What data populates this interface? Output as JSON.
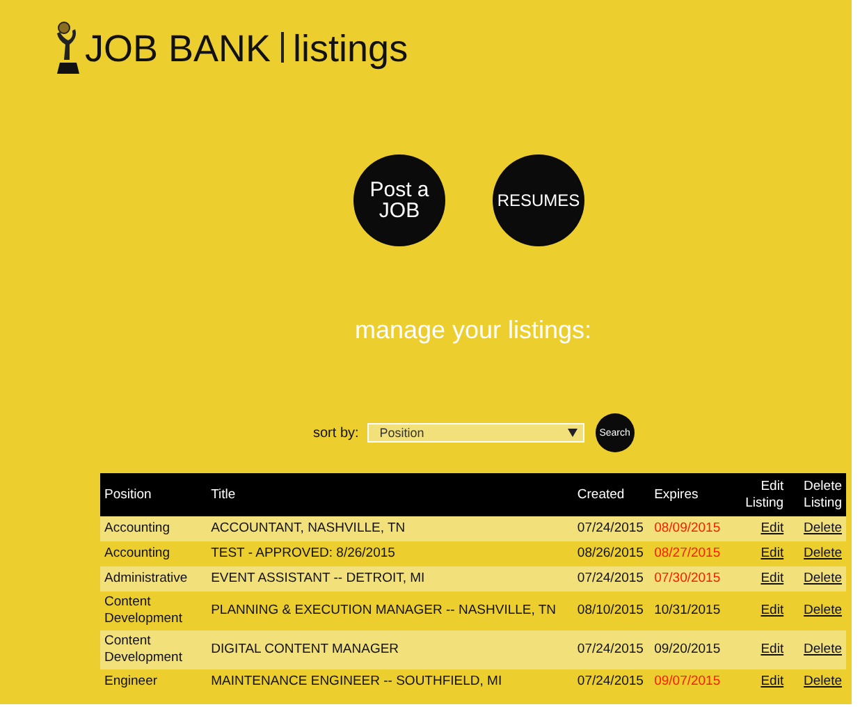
{
  "header": {
    "brand": "JOB BANK",
    "section": "listings"
  },
  "actions": [
    {
      "label": "Post a JOB"
    },
    {
      "label": "RESUMES"
    }
  ],
  "heading": "manage your listings:",
  "sort": {
    "label": "sort by:",
    "value": "Position",
    "button": "Search"
  },
  "table": {
    "columns": [
      "Position",
      "Title",
      "Created",
      "Expires",
      "Edit Listing",
      "Delete Listing"
    ],
    "rows": [
      {
        "position": "Accounting",
        "title": "ACCOUNTANT, NASHVILLE, TN",
        "created": "07/24/2015",
        "expires": "08/09/2015",
        "expired": true,
        "edit": "Edit",
        "delete": "Delete"
      },
      {
        "position": "Accounting",
        "title": "TEST - APPROVED: 8/26/2015",
        "created": "08/26/2015",
        "expires": "08/27/2015",
        "expired": true,
        "edit": "Edit",
        "delete": "Delete"
      },
      {
        "position": "Administrative",
        "title": "EVENT ASSISTANT -- DETROIT, MI",
        "created": "07/24/2015",
        "expires": "07/30/2015",
        "expired": true,
        "edit": "Edit",
        "delete": "Delete"
      },
      {
        "position": "Content Development",
        "title": "PLANNING & EXECUTION MANAGER -- NASHVILLE, TN",
        "created": "08/10/2015",
        "expires": "10/31/2015",
        "expired": false,
        "edit": "Edit",
        "delete": "Delete"
      },
      {
        "position": "Content Development",
        "title": "DIGITAL CONTENT MANAGER",
        "created": "07/24/2015",
        "expires": "09/20/2015",
        "expired": false,
        "edit": "Edit",
        "delete": "Delete"
      },
      {
        "position": "Engineer",
        "title": "MAINTENANCE ENGINEER -- SOUTHFIELD, MI",
        "created": "07/24/2015",
        "expires": "09/07/2015",
        "expired": true,
        "edit": "Edit",
        "delete": "Delete"
      }
    ]
  }
}
